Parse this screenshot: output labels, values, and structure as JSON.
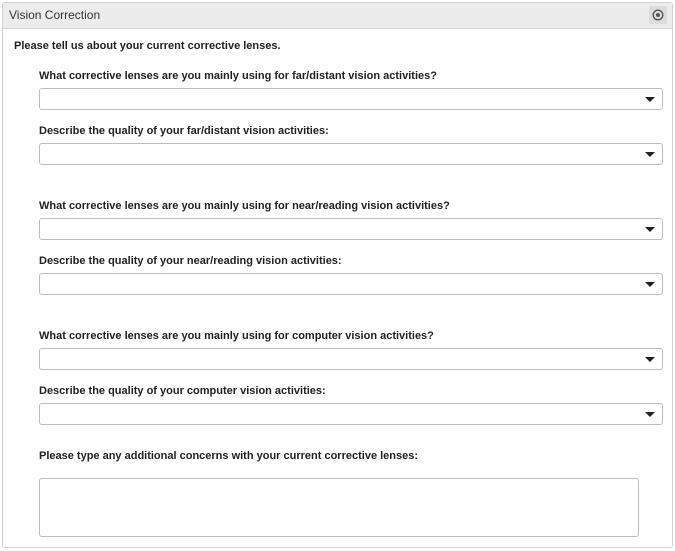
{
  "panel": {
    "title": "Vision Correction",
    "collapse_icon": "circle-dot-icon"
  },
  "intro": "Please tell us about your current corrective lenses.",
  "questions": [
    {
      "label": "What corrective lenses are you mainly using for far/distant vision activities?",
      "value": ""
    },
    {
      "label": "Describe the quality of your far/distant vision activities:",
      "value": ""
    },
    {
      "label": "What corrective lenses are you mainly using for near/reading vision activities?",
      "value": ""
    },
    {
      "label": "Describe the quality of your near/reading vision activities:",
      "value": ""
    },
    {
      "label": "What corrective lenses are you mainly using for computer vision activities?",
      "value": ""
    },
    {
      "label": "Describe the quality of your computer vision activities:",
      "value": ""
    }
  ],
  "concerns": {
    "label": "Please type any additional concerns with your current corrective lenses:",
    "value": ""
  }
}
